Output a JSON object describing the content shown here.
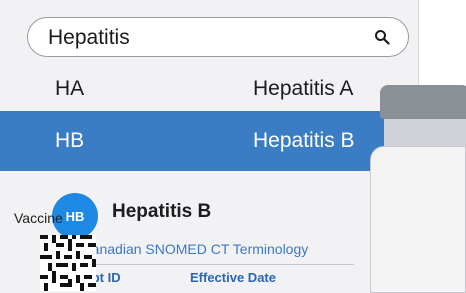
{
  "search": {
    "value": "Hepatitis"
  },
  "results": [
    {
      "code": "HA",
      "name": "Hepatitis A"
    },
    {
      "code": "HB",
      "name": "Hepatitis B"
    }
  ],
  "detail": {
    "badge": "HB",
    "title": "Hepatitis B",
    "terminology": "Pan-Canadian SNOMED CT Terminology",
    "concept_id_label": "Concept ID",
    "effective_date_label": "Effective Date"
  },
  "bottle": {
    "label": "Vaccine"
  },
  "colors": {
    "accent": "#3a7dc4",
    "badge": "#1e88e5"
  }
}
